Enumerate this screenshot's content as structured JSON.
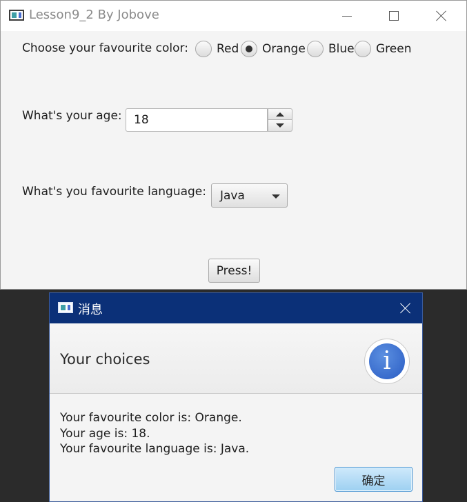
{
  "main_window": {
    "title": "Lesson9_2 By Jobove",
    "color_question": "Choose your favourite color:",
    "color_options": [
      {
        "label": "Red",
        "checked": false
      },
      {
        "label": "Orange",
        "checked": true
      },
      {
        "label": "Blue",
        "checked": false
      },
      {
        "label": "Green",
        "checked": false
      }
    ],
    "age_question": "What's your age:",
    "age_value": "18",
    "language_question": "What's you favourite language:",
    "language_value": "Java",
    "press_label": "Press!"
  },
  "dialog": {
    "title": "消息",
    "header": "Your choices",
    "info_icon_glyph": "i",
    "lines": [
      "Your favourite color is: Orange.",
      "Your age is: 18.",
      "Your favourite language is: Java."
    ],
    "ok_label": "确定"
  },
  "icons": {
    "window_icon": "app-window-icon",
    "minimize": "minimize-icon",
    "maximize": "maximize-icon",
    "close": "close-icon",
    "info": "info-icon"
  },
  "colors": {
    "dialog_titlebar": "#0b3078",
    "info_accent": "#2a5cc4",
    "ok_button": "#9dd0f1"
  }
}
